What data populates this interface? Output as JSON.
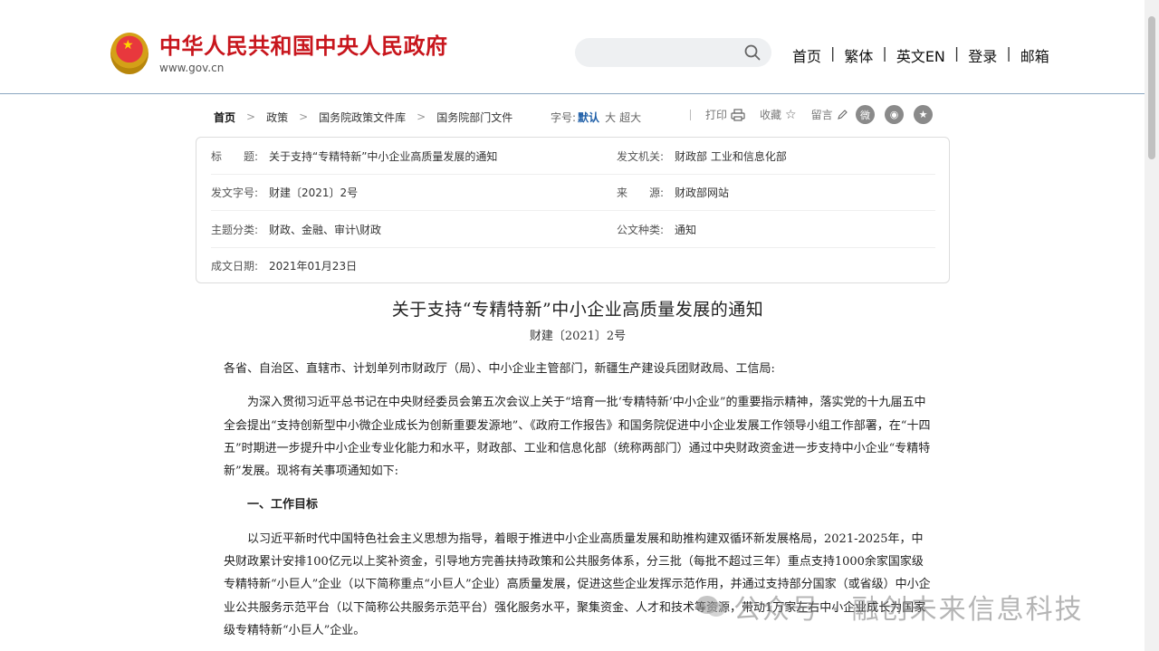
{
  "header": {
    "site_title": "中华人民共和国中央人民政府",
    "site_url": "www.gov.cn",
    "search_placeholder": "",
    "nav": [
      "首页",
      "繁体",
      "英文EN",
      "登录",
      "邮箱"
    ]
  },
  "breadcrumb": [
    "首页",
    "政策",
    "国务院政策文件库",
    "国务院部门文件"
  ],
  "fontsize": {
    "label": "字号:",
    "default": "默认",
    "large": "大",
    "xlarge": "超大"
  },
  "tools": {
    "print": "打印",
    "favorite": "收藏",
    "comment": "留言"
  },
  "info": {
    "title_key": "标　　题:",
    "title_val": "关于支持“专精特新”中小企业高质量发展的通知",
    "issuer_key": "发文机关:",
    "issuer_val": "财政部 工业和信息化部",
    "docno_key": "发文字号:",
    "docno_val": "财建〔2021〕2号",
    "source_key": "来　　源:",
    "source_val": "财政部网站",
    "topic_key": "主题分类:",
    "topic_val": "财政、金融、审计\\财政",
    "type_key": "公文种类:",
    "type_val": "通知",
    "date_key": "成文日期:",
    "date_val": "2021年01月23日"
  },
  "article": {
    "title": "关于支持“专精特新”中小企业高质量发展的通知",
    "doc_no": "财建〔2021〕2号",
    "salutation": "各省、自治区、直辖市、计划单列市财政厅（局）、中小企业主管部门，新疆生产建设兵团财政局、工信局:",
    "para1": "为深入贯彻习近平总书记在中央财经委员会第五次会议上关于“培育一批‘专精特新’中小企业”的重要指示精神，落实党的十九届五中全会提出“支持创新型中小微企业成长为创新重要发源地”、《政府工作报告》和国务院促进中小企业发展工作领导小组工作部署，在“十四五”时期进一步提升中小企业专业化能力和水平，财政部、工业和信息化部（统称两部门）通过中央财政资金进一步支持中小企业“专精特新”发展。现将有关事项通知如下:",
    "heading1": "一、工作目标",
    "para2": "以习近平新时代中国特色社会主义思想为指导，着眼于推进中小企业高质量发展和助推构建双循环新发展格局，2021-2025年，中央财政累计安排100亿元以上奖补资金，引导地方完善扶持政策和公共服务体系，分三批（每批不超过三年）重点支持1000余家国家级专精特新“小巨人”企业（以下简称重点“小巨人”企业）高质量发展，促进这些企业发挥示范作用，并通过支持部分国家（或省级）中小企业公共服务示范平台（以下简称公共服务示范平台）强化服务水平，聚集资金、人才和技术等资源，带动1万家左右中小企业成长为国家级专精特新“小巨人”企业。"
  },
  "watermark": "公众号 · 融创未来信息科技"
}
